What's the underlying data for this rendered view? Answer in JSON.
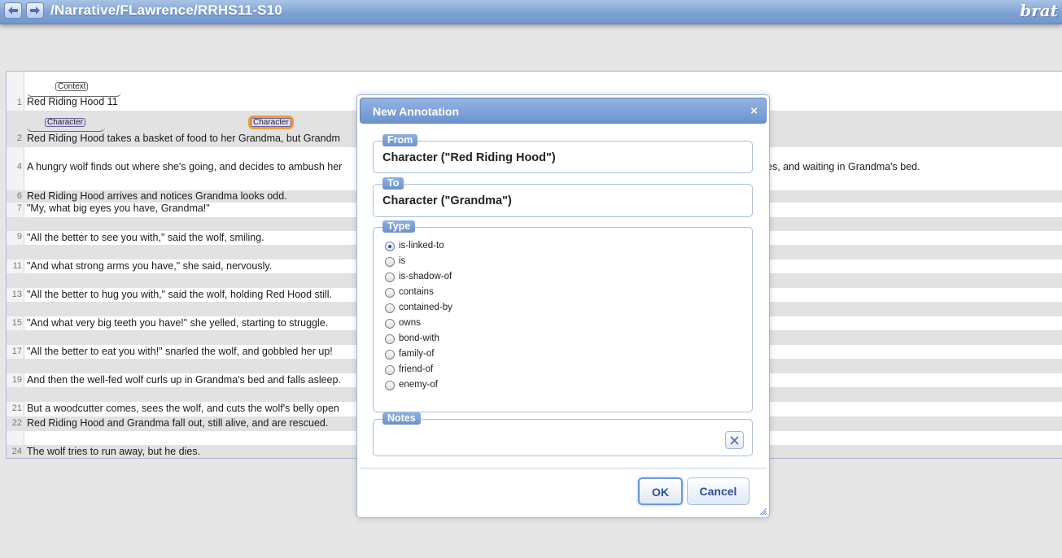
{
  "header": {
    "doc_path": "/Narrative/FLawrence/RRHS11-S10",
    "logo": "brat",
    "back_icon": "arrow-left-icon",
    "forward_icon": "arrow-right-icon"
  },
  "document": {
    "lines": [
      {
        "num": "1",
        "text": "Red Riding Hood 11"
      },
      {
        "num": "2",
        "text": "Red Riding Hood takes a basket of food to her  Grandma,  but Grandm"
      },
      {
        "num": "4",
        "text": "A hungry wolf finds out where she's going, and decides to ambush her"
      },
      {
        "num": "6",
        "text": "Red Riding Hood arrives and notices Grandma looks odd."
      },
      {
        "num": "7",
        "text": "\"My, what big eyes you have, Grandma!\""
      },
      {
        "num": "9",
        "text": "\"All the better to see you with,\" said the wolf, smiling."
      },
      {
        "num": "11",
        "text": "\"And what strong arms you have,\" she said, nervously."
      },
      {
        "num": "13",
        "text": "\"All the better to hug you with,\" said the wolf, holding Red Hood still."
      },
      {
        "num": "15",
        "text": "\"And what very big teeth you have!\" she yelled, starting to struggle."
      },
      {
        "num": "17",
        "text": "\"All the better to eat you with!\" snarled the wolf, and gobbled her up!"
      },
      {
        "num": "19",
        "text": "And then the well-fed wolf curls up in Grandma's bed and falls asleep."
      },
      {
        "num": "21",
        "text": "But a woodcutter comes, sees the wolf, and cuts the wolf's belly open"
      },
      {
        "num": "22",
        "text": "Red Riding Hood and Grandma fall out, still alive, and are rescued."
      },
      {
        "num": "24",
        "text": "The wolf tries to run away, but he dies."
      }
    ],
    "line4_tail": "es, and waiting in Grandma's bed.",
    "annotations": {
      "context": "Context",
      "character1": "Character",
      "character2": "Character"
    },
    "colors": {
      "selected_highlight": "#f0a030",
      "character_bg": "#dcd6f0"
    }
  },
  "dialog": {
    "title": "New Annotation",
    "close_icon": "close-icon",
    "from_legend": "From",
    "from_value": "Character (\"Red Riding Hood\")",
    "to_legend": "To",
    "to_value": "Character (\"Grandma\")",
    "type_legend": "Type",
    "types": [
      {
        "label": "is-linked-to",
        "checked": true
      },
      {
        "label": "is",
        "checked": false
      },
      {
        "label": "is-shadow-of",
        "checked": false
      },
      {
        "label": "contains",
        "checked": false
      },
      {
        "label": "contained-by",
        "checked": false
      },
      {
        "label": "owns",
        "checked": false
      },
      {
        "label": "bond-with",
        "checked": false
      },
      {
        "label": "family-of",
        "checked": false
      },
      {
        "label": "friend-of",
        "checked": false
      },
      {
        "label": "enemy-of",
        "checked": false
      }
    ],
    "notes_legend": "Notes",
    "notes_value": "",
    "ok_label": "OK",
    "cancel_label": "Cancel"
  }
}
